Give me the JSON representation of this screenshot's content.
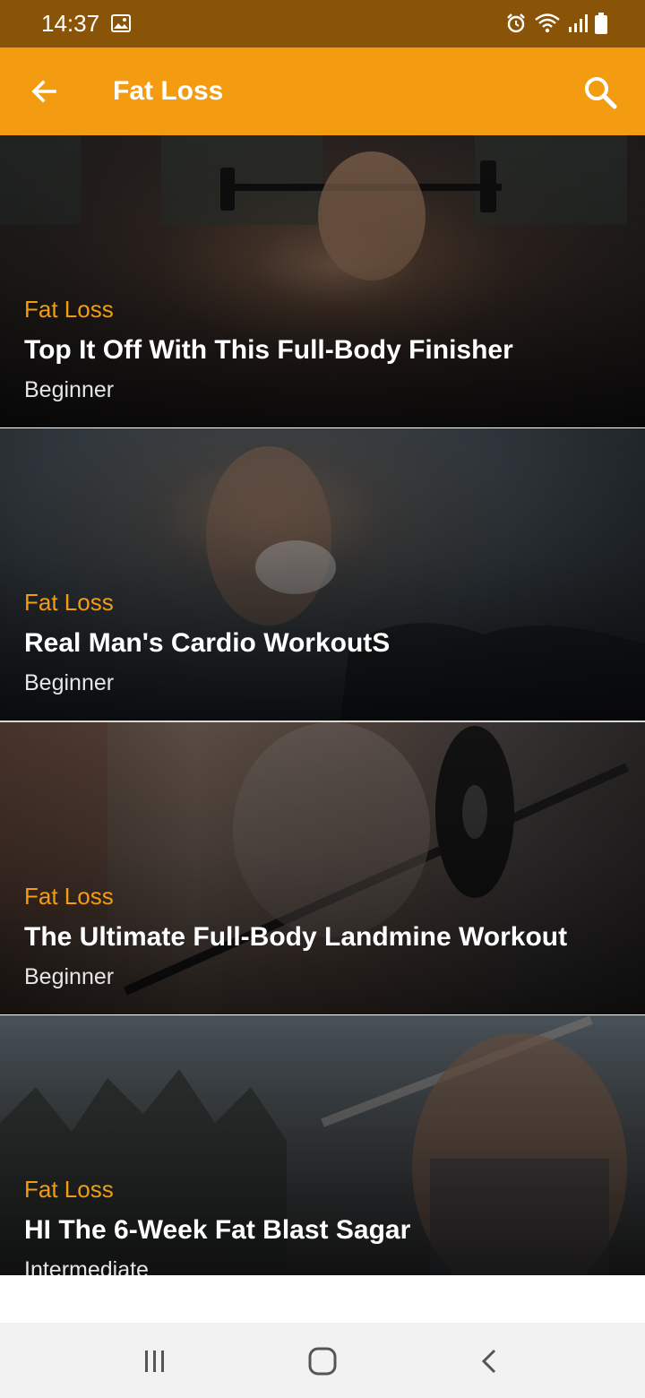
{
  "status_bar": {
    "time": "14:37",
    "left_icons": [
      "gallery-icon"
    ],
    "right_icons": [
      "alarm-icon",
      "wifi-icon",
      "signal-icon",
      "battery-icon"
    ]
  },
  "app_bar": {
    "title": "Fat Loss",
    "back_icon": "arrow-back-icon",
    "search_icon": "search-icon",
    "color": "#f39c12"
  },
  "workouts": [
    {
      "category": "Fat Loss",
      "title": "Top It Off With This Full-Body Finisher",
      "level": "Beginner"
    },
    {
      "category": "Fat Loss",
      "title": "Real Man's Cardio WorkoutS",
      "level": "Beginner"
    },
    {
      "category": "Fat Loss",
      "title": "The Ultimate Full-Body Landmine Workout",
      "level": "Beginner"
    },
    {
      "category": "Fat Loss",
      "title": "HI The 6-Week Fat Blast Sagar",
      "level": "Intermediate"
    }
  ],
  "colors": {
    "status_bar": "#8a5408",
    "accent": "#f39c12",
    "nav_bar": "#f2f2f2"
  },
  "nav_bar": {
    "icons": [
      "recent-apps-icon",
      "home-icon",
      "back-icon"
    ]
  }
}
